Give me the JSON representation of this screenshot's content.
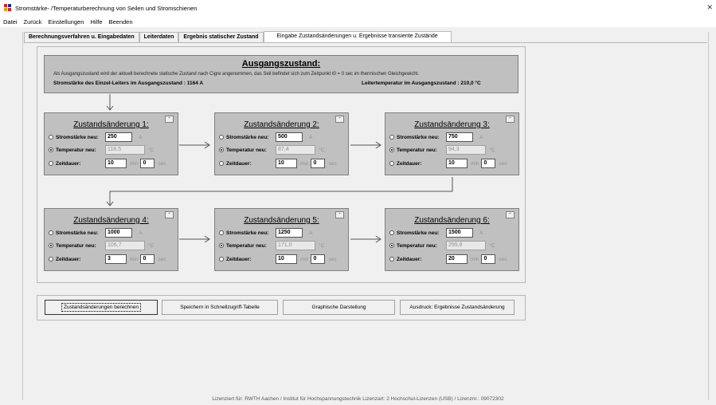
{
  "window": {
    "title": "Stromstärke- /Temperaturberechnung von Seilen und Stromschienen",
    "close_glyph": "✕"
  },
  "menu": [
    "Datei",
    "Zurück",
    "Einstellungen",
    "Hilfe",
    "Beenden"
  ],
  "tabs": [
    {
      "label": "Berechnungsverfahren u. Eingabedaten"
    },
    {
      "label": "Leiterdaten"
    },
    {
      "label": "Ergebnis statischer Zustand"
    },
    {
      "label": "Eingabe Zustandsänderungen u. Ergebnisse transiente Zustände"
    }
  ],
  "initial": {
    "heading": "Ausgangszustand:",
    "description": "Als Ausgangszustand wird der aktuell berechnete statische Zustand nach Cigre angenommen, das Seil befindet sich zum Zeitpunkt t0 = 0 sec im thermischen Gleichgewicht.",
    "current_text": "Stromstärke des Einzel-Leiters im Ausgangszustand :   1164 A",
    "temp_text": "Leitertemperatur im Ausgangszustand :   210,0 °C"
  },
  "labels": {
    "current": "Stromstärke neu:",
    "temperature": "Temperatur neu:",
    "duration": "Zeitdauer:",
    "unit_a": "A",
    "unit_c": "°C",
    "unit_min": "min",
    "unit_sec": "sec",
    "minimize": "-"
  },
  "states": [
    {
      "title": "Zustandsänderung 1:",
      "current": "250",
      "temperature": "118,5",
      "minutes": "10",
      "seconds": "0"
    },
    {
      "title": "Zustandsänderung 2:",
      "current": "500",
      "temperature": "87,4",
      "minutes": "10",
      "seconds": "0"
    },
    {
      "title": "Zustandsänderung 3:",
      "current": "750",
      "temperature": "94,3",
      "minutes": "10",
      "seconds": "0"
    },
    {
      "title": "Zustandsänderung 4:",
      "current": "1000",
      "temperature": "106,7",
      "minutes": "3",
      "seconds": "0"
    },
    {
      "title": "Zustandsänderung 5:",
      "current": "1250",
      "temperature": "171,0",
      "minutes": "10",
      "seconds": "0"
    },
    {
      "title": "Zustandsänderung 6:",
      "current": "1500",
      "temperature": "299,8",
      "minutes": "20",
      "seconds": "0"
    }
  ],
  "buttons": {
    "calculate": "Zustandsänderungen berechnen",
    "save": "Speichern in Schnellzugriff-Tabelle",
    "graph": "Graphische Darstellung",
    "print": "Ausdruck: Ergebnisse Zustandsänderung"
  },
  "status": "Lizenziert für: RWTH Aachen / Institut für Hochspannungstechnik Lizenzart:  2 Hochschul-Lizenzen (USB) / Lizenznr.: 09072302"
}
